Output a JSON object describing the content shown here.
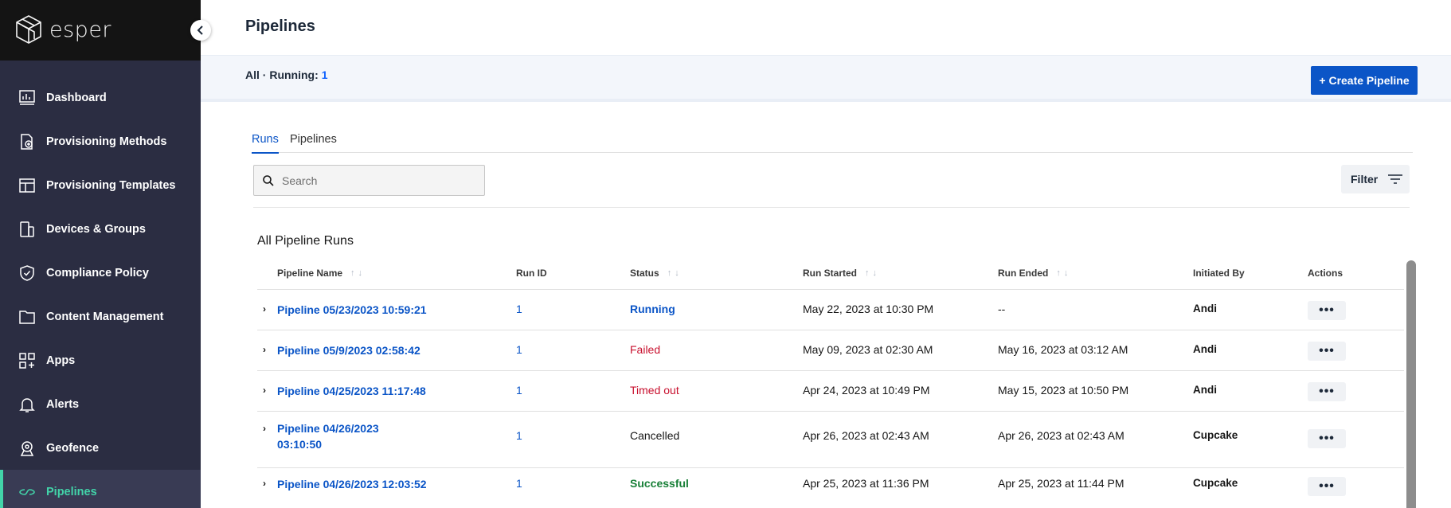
{
  "brand": {
    "name": "esper"
  },
  "sidebar": {
    "items": [
      {
        "label": "Dashboard",
        "icon": "dashboard-icon"
      },
      {
        "label": "Provisioning Methods",
        "icon": "provisioning-methods-icon"
      },
      {
        "label": "Provisioning Templates",
        "icon": "provisioning-templates-icon"
      },
      {
        "label": "Devices & Groups",
        "icon": "devices-icon"
      },
      {
        "label": "Compliance Policy",
        "icon": "shield-icon"
      },
      {
        "label": "Content Management",
        "icon": "folder-icon"
      },
      {
        "label": "Apps",
        "icon": "apps-icon"
      },
      {
        "label": "Alerts",
        "icon": "bell-icon"
      },
      {
        "label": "Geofence",
        "icon": "geofence-icon"
      },
      {
        "label": "Pipelines",
        "icon": "pipelines-icon",
        "active": true
      }
    ]
  },
  "header": {
    "title": "Pipelines"
  },
  "summary": {
    "all_label": "All · Running:",
    "running_count": "1"
  },
  "toolbar": {
    "create_label": "+ Create Pipeline",
    "filter_label": "Filter"
  },
  "tabs": [
    {
      "label": "Runs",
      "active": true
    },
    {
      "label": "Pipelines",
      "active": false
    }
  ],
  "search": {
    "placeholder": "Search",
    "value": ""
  },
  "table": {
    "title": "All Pipeline Runs",
    "columns": [
      "Pipeline Name",
      "Run ID",
      "Status",
      "Run Started",
      "Run Ended",
      "Initiated By",
      "Actions"
    ],
    "rows": [
      {
        "name": "Pipeline 05/23/2023 10:59:21",
        "run_id": "1",
        "status": "Running",
        "started": "May 22, 2023 at 10:30 PM",
        "ended": "--",
        "by": "Andi",
        "actions": "•••"
      },
      {
        "name": "Pipeline 05/9/2023 02:58:42",
        "run_id": "1",
        "status": "Failed",
        "started": "May 09, 2023 at 02:30 AM",
        "ended": "May 16, 2023 at 03:12 AM",
        "by": "Andi",
        "actions": "•••"
      },
      {
        "name": "Pipeline 04/25/2023 11:17:48",
        "run_id": "1",
        "status": "Timed out",
        "started": "Apr 24, 2023 at 10:49 PM",
        "ended": "May 15, 2023 at 10:50 PM",
        "by": "Andi",
        "actions": "•••"
      },
      {
        "name": "Pipeline 04/26/2023 03:10:50",
        "run_id": "1",
        "status": "Cancelled",
        "started": "Apr 26, 2023 at 02:43 AM",
        "ended": "Apr 26, 2023 at 02:43 AM",
        "by": "Cupcake",
        "actions": "•••"
      },
      {
        "name": "Pipeline 04/26/2023 12:03:52",
        "run_id": "1",
        "status": "Successful",
        "started": "Apr 25, 2023 at 11:36 PM",
        "ended": "Apr 25, 2023 at 11:44 PM",
        "by": "Cupcake",
        "actions": "•••"
      }
    ]
  },
  "colors": {
    "accent": "#0b55c7",
    "sidebar_bg": "#2b2d42",
    "active_nav": "#42d4a9",
    "status_running": "#0b55c7",
    "status_failed": "#c8102e",
    "status_timed_out": "#c8102e",
    "status_cancelled": "#161616",
    "status_successful": "#198038"
  }
}
